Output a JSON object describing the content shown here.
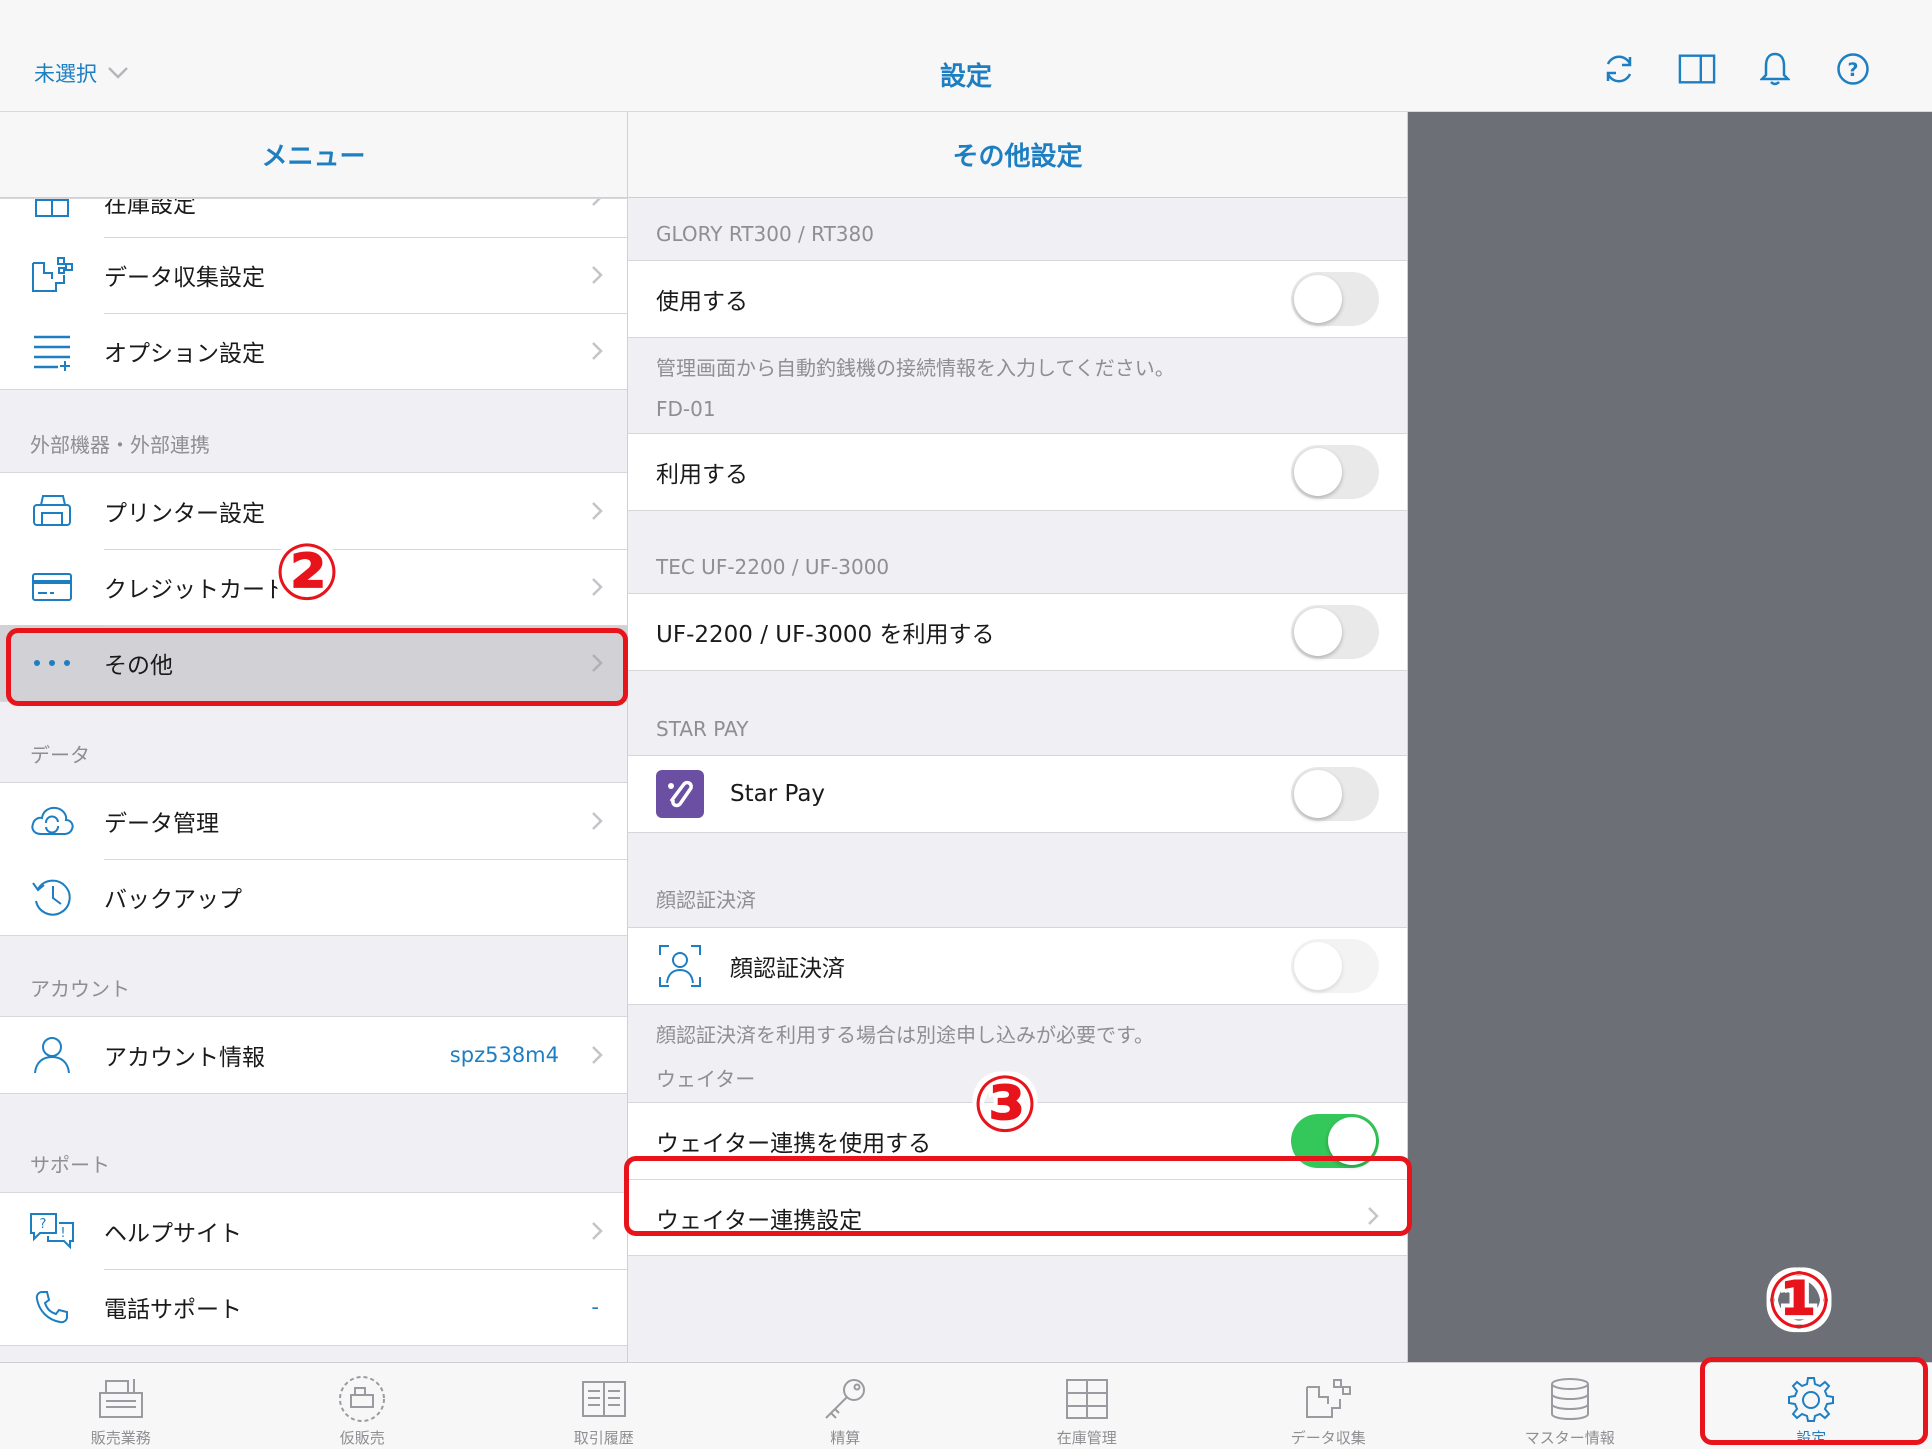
{
  "topbar": {
    "store_select": "未選択",
    "title": "設定",
    "icons": [
      "refresh-icon",
      "split-view-icon",
      "bell-icon",
      "help-icon"
    ]
  },
  "menu": {
    "header": "メニュー",
    "partial_item": "在庫設定",
    "items_top": [
      {
        "label": "データ収集設定",
        "icon": "data-collect-icon"
      },
      {
        "label": "オプション設定",
        "icon": "options-icon"
      }
    ],
    "section_external": "外部機器・外部連携",
    "items_external": [
      {
        "label": "プリンター設定",
        "icon": "printer-icon"
      },
      {
        "label": "クレジットカード",
        "icon": "credit-card-icon"
      },
      {
        "label": "その他",
        "icon": "more-icon"
      }
    ],
    "section_data": "データ",
    "items_data": [
      {
        "label": "データ管理",
        "icon": "cloud-sync-icon"
      },
      {
        "label": "バックアップ",
        "icon": "backup-icon"
      }
    ],
    "section_account": "アカウント",
    "account": {
      "label": "アカウント情報",
      "value": "spz538m4"
    },
    "section_support": "サポート",
    "items_support": [
      {
        "label": "ヘルプサイト",
        "icon": "help-chat-icon"
      },
      {
        "label": "電話サポート",
        "icon": "phone-icon",
        "value": "-"
      }
    ]
  },
  "detail": {
    "header": "その他設定",
    "glory": {
      "section": "GLORY RT300 / RT380",
      "label": "使用する",
      "note": "管理画面から自動釣銭機の接続情報を入力してください。"
    },
    "fd01": {
      "section": "FD-01",
      "label": "利用する"
    },
    "tec": {
      "section": "TEC UF-2200 / UF-3000",
      "label": "UF-2200 / UF-3000 を利用する"
    },
    "starpay": {
      "section": "STAR PAY",
      "label": "Star Pay"
    },
    "face": {
      "section": "顔認証決済",
      "label": "顔認証決済",
      "note": "顔認証決済を利用する場合は別途申し込みが必要です。"
    },
    "waiter": {
      "section": "ウェイター",
      "toggle_label": "ウェイター連携を使用する",
      "settings_label": "ウェイター連携設定"
    }
  },
  "annotations": {
    "one": "①",
    "two": "②",
    "three": "③"
  },
  "tabbar": [
    {
      "label": "販売業務",
      "icon": "register-icon"
    },
    {
      "label": "仮販売",
      "icon": "temp-sale-icon"
    },
    {
      "label": "取引履歴",
      "icon": "history-icon"
    },
    {
      "label": "精算",
      "icon": "key-icon"
    },
    {
      "label": "在庫管理",
      "icon": "inventory-icon"
    },
    {
      "label": "データ収集",
      "icon": "data-collect-icon"
    },
    {
      "label": "マスター情報",
      "icon": "database-icon"
    },
    {
      "label": "設定",
      "icon": "gear-icon"
    }
  ],
  "colors": {
    "accent": "#1d7fc2",
    "highlight": "#e8141c",
    "toggle_on": "#34c759"
  }
}
